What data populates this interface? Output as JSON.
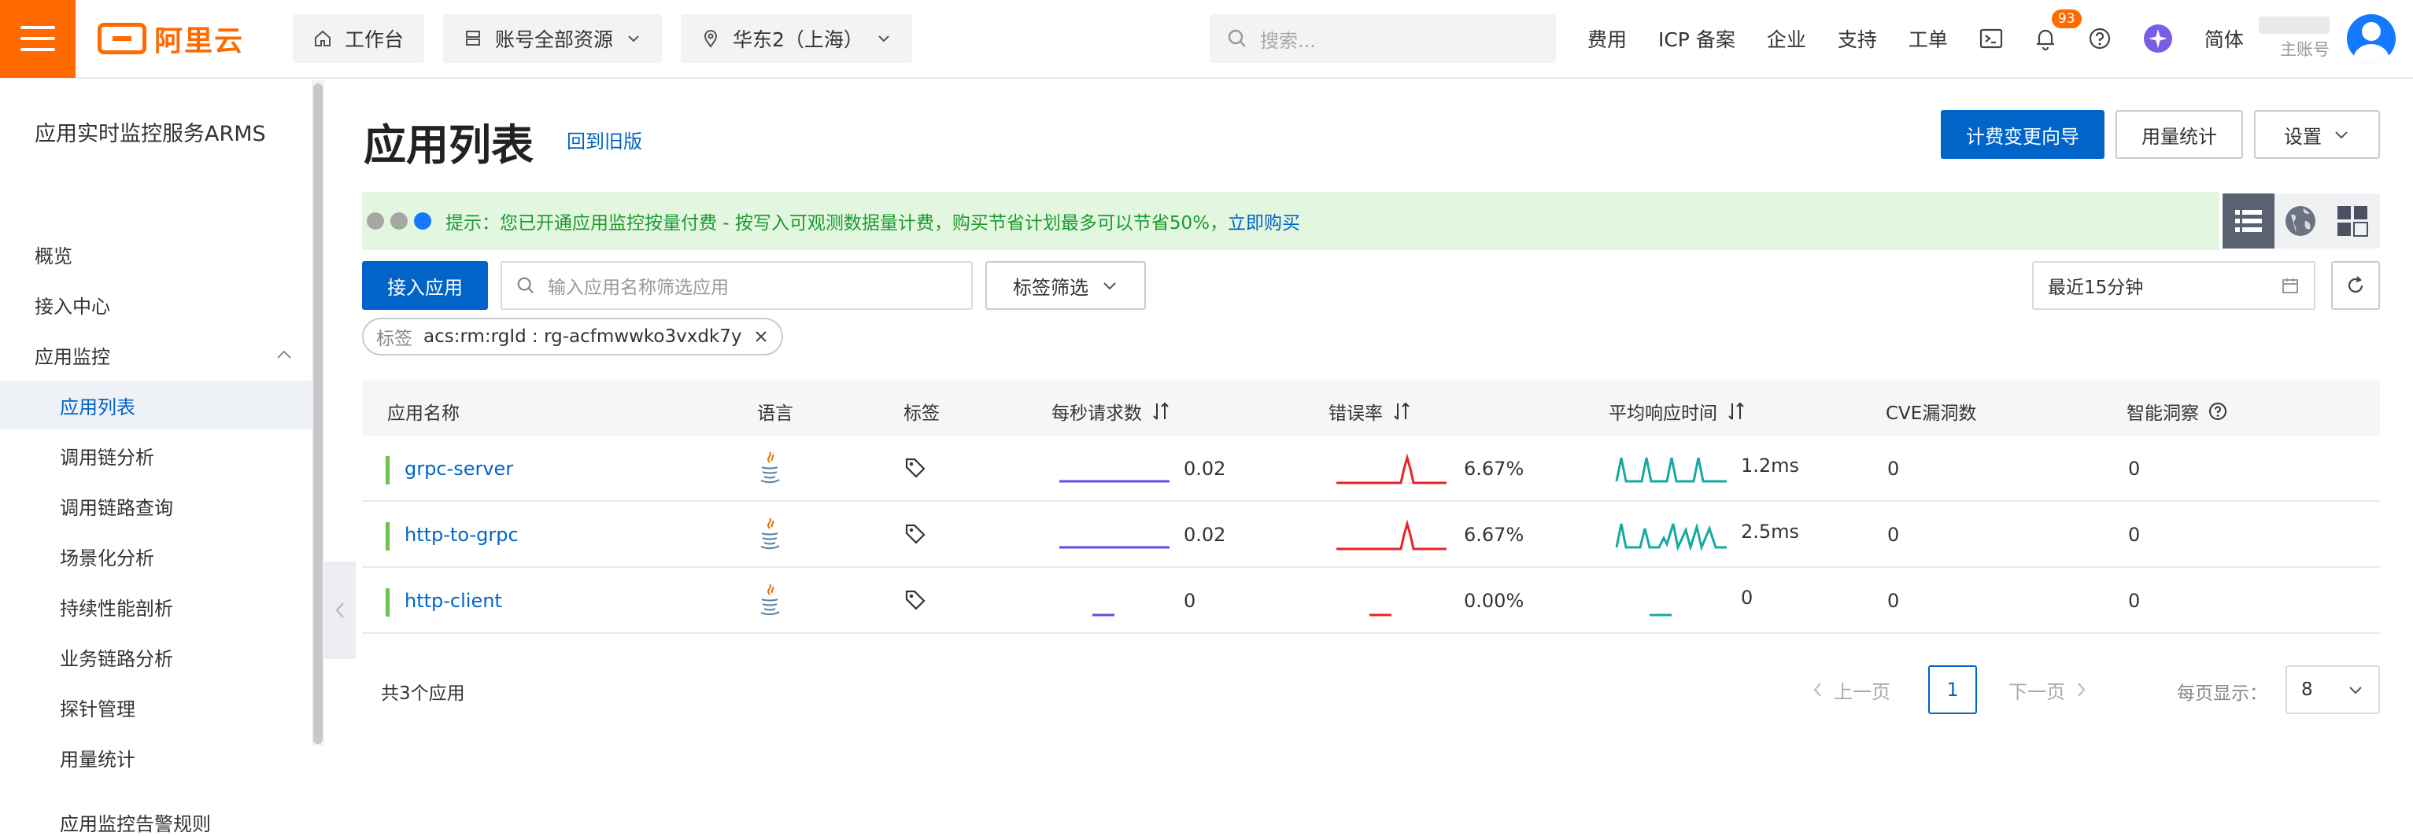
{
  "topbar": {
    "logo_text": "阿里云",
    "workbench": "工作台",
    "resources": "账号全部资源",
    "region": "华东2（上海）",
    "search_placeholder": "搜索...",
    "links": [
      "费用",
      "ICP 备案",
      "企业",
      "支持",
      "工单"
    ],
    "notification_count": "93",
    "language": "简体",
    "account_label": "主账号"
  },
  "sidebar": {
    "title": "应用实时监控服务ARMS",
    "items": [
      {
        "label": "概览",
        "sub": false,
        "active": false
      },
      {
        "label": "接入中心",
        "sub": false,
        "active": false
      },
      {
        "label": "应用监控",
        "sub": false,
        "active": false,
        "expandable": true
      },
      {
        "label": "应用列表",
        "sub": true,
        "active": true
      },
      {
        "label": "调用链分析",
        "sub": true,
        "active": false
      },
      {
        "label": "调用链路查询",
        "sub": true,
        "active": false
      },
      {
        "label": "场景化分析",
        "sub": true,
        "active": false
      },
      {
        "label": "持续性能剖析",
        "sub": true,
        "active": false
      },
      {
        "label": "业务链路分析",
        "sub": true,
        "active": false
      },
      {
        "label": "探针管理",
        "sub": true,
        "active": false
      },
      {
        "label": "用量统计",
        "sub": true,
        "active": false
      },
      {
        "label": "应用监控告警规则",
        "sub": true,
        "active": false
      }
    ]
  },
  "main": {
    "title": "应用列表",
    "back_link": "回到旧版",
    "billing_wizard": "计费变更向导",
    "usage_stats": "用量统计",
    "settings": "设置",
    "notice_text": "提示：您已开通应用监控按量付费 - 按写入可观测数据量计费，购买节省计划最多可以节省50%，",
    "notice_link": "立即购买",
    "connect_app": "接入应用",
    "filter_placeholder": "输入应用名称筛选应用",
    "tag_filter": "标签筛选",
    "time_range": "最近15分钟",
    "active_tag": {
      "key": "标签",
      "value": "acs:rm:rgId : rg-acfmwwko3vxdk7y"
    }
  },
  "table": {
    "columns": [
      "应用名称",
      "语言",
      "标签",
      "每秒请求数",
      "错误率",
      "平均响应时间",
      "CVE漏洞数",
      "智能洞察"
    ],
    "rows": [
      {
        "name": "grpc-server",
        "qps": "0.02",
        "error_rate": "6.67%",
        "rt": "1.2ms",
        "cve": "0",
        "insight": "0"
      },
      {
        "name": "http-to-grpc",
        "qps": "0.02",
        "error_rate": "6.67%",
        "rt": "2.5ms",
        "cve": "0",
        "insight": "0"
      },
      {
        "name": "http-client",
        "qps": "0",
        "error_rate": "0.00%",
        "rt": "0",
        "cve": "0",
        "insight": "0"
      }
    ]
  },
  "footer": {
    "total": "共3个应用",
    "prev": "上一页",
    "next": "下一页",
    "current_page": "1",
    "per_page_label": "每页显示：",
    "per_page_value": "8"
  },
  "colors": {
    "primary": "#0064c8",
    "brand": "#ff6a00",
    "qps_line": "#5b4fe8",
    "error_line": "#e5232a",
    "rt_line": "#16a9a1"
  }
}
